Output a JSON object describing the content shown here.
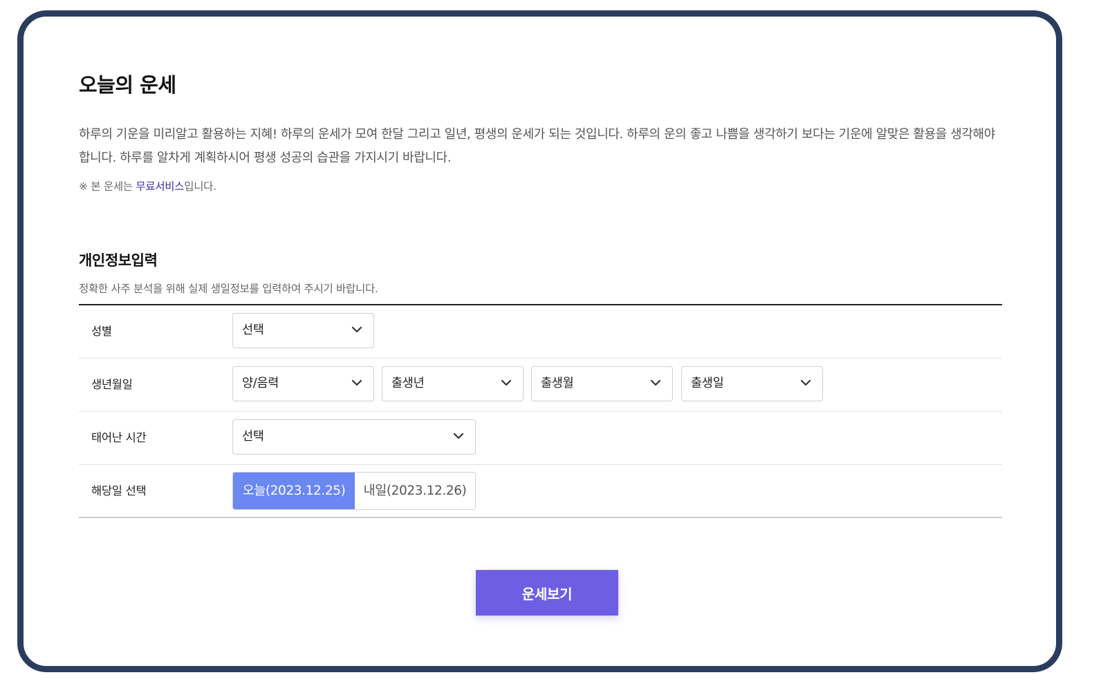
{
  "title": "오늘의 운세",
  "intro": "하루의 기운을 미리알고 활용하는 지혜! 하루의 운세가 모여 한달 그리고 일년, 평생의 운세가 되는 것입니다. 하루의 운의 좋고 나쁨을 생각하기 보다는 기운에 알맞은 활용을 생각해야 합니다. 하루를 알차게 계획하시어 평생 성공의 습관을 가지시기 바랍니다.",
  "note": {
    "prefix": "※ 본 운세는 ",
    "link": "무료서비스",
    "suffix": "입니다."
  },
  "section": {
    "title": "개인정보입력",
    "description": "정확한 사주 분석을 위해 실제 생일정보를 입력하여 주시기 바랍니다."
  },
  "form": {
    "gender": {
      "label": "성별",
      "select": "선택"
    },
    "birthdate": {
      "label": "생년월일",
      "calendar": "양/음력",
      "year": "출생년",
      "month": "출생월",
      "day": "출생일"
    },
    "birth_time": {
      "label": "태어난 시간",
      "select": "선택"
    },
    "target_day": {
      "label": "해당일 선택",
      "today": "오늘(2023.12.25)",
      "tomorrow": "내일(2023.12.26)",
      "selected": "today"
    }
  },
  "submit_label": "운세보기",
  "icons": {
    "dropdown": "chevron-down-icon"
  },
  "colors": {
    "frame_border": "#2b3d5e",
    "active_segment": "#6b87f2",
    "submit_button": "#6d5ee3",
    "link": "#3b2fa3"
  }
}
